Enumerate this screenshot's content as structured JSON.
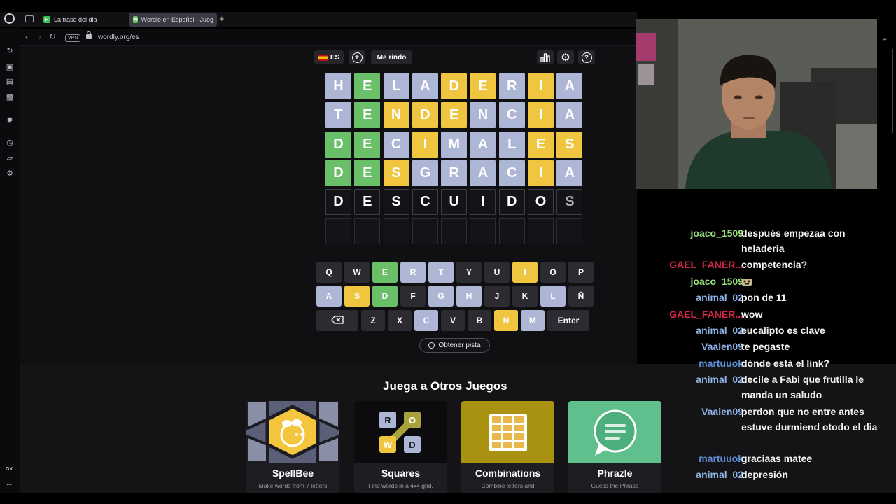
{
  "browser": {
    "tabs": [
      {
        "label": "La frase del dia",
        "favicon": "P",
        "favicon_color": "#3fbf5a"
      },
      {
        "label": "Wordle en Español - Jueg",
        "favicon": "W",
        "favicon_color": "#6ac068"
      }
    ],
    "new_tab": "+",
    "vpn_badge": "VPN",
    "url": "wordly.org/es"
  },
  "toolbar": {
    "language": "ES",
    "give_up": "Me rindo"
  },
  "board": {
    "rows": [
      {
        "letters": [
          "H",
          "E",
          "L",
          "A",
          "D",
          "E",
          "R",
          "I",
          "A"
        ],
        "states": [
          "x",
          "g",
          "x",
          "x",
          "y",
          "y",
          "x",
          "y",
          "x"
        ]
      },
      {
        "letters": [
          "T",
          "E",
          "N",
          "D",
          "E",
          "N",
          "C",
          "I",
          "A"
        ],
        "states": [
          "x",
          "g",
          "y",
          "y",
          "y",
          "x",
          "x",
          "y",
          "x"
        ]
      },
      {
        "letters": [
          "D",
          "E",
          "C",
          "I",
          "M",
          "A",
          "L",
          "E",
          "S"
        ],
        "states": [
          "g",
          "g",
          "x",
          "y",
          "x",
          "x",
          "x",
          "y",
          "y"
        ]
      },
      {
        "letters": [
          "D",
          "E",
          "S",
          "G",
          "R",
          "A",
          "C",
          "I",
          "A"
        ],
        "states": [
          "g",
          "g",
          "y",
          "x",
          "x",
          "x",
          "x",
          "y",
          "x"
        ]
      },
      {
        "letters": [
          "D",
          "E",
          "S",
          "C",
          "U",
          "I",
          "D",
          "O",
          "S"
        ],
        "states": [
          "cur",
          "cur",
          "cur",
          "cur",
          "cur",
          "cur",
          "cur",
          "cur",
          "cur"
        ]
      },
      {
        "letters": [
          "",
          "",
          "",
          "",
          "",
          "",
          "",
          "",
          ""
        ],
        "states": [
          "e",
          "e",
          "e",
          "e",
          "e",
          "e",
          "e",
          "e",
          "e"
        ]
      }
    ]
  },
  "keyboard": {
    "row1": [
      {
        "k": "Q",
        "s": ""
      },
      {
        "k": "W",
        "s": ""
      },
      {
        "k": "E",
        "s": "g"
      },
      {
        "k": "R",
        "s": "x"
      },
      {
        "k": "T",
        "s": "x"
      },
      {
        "k": "Y",
        "s": ""
      },
      {
        "k": "U",
        "s": ""
      },
      {
        "k": "I",
        "s": "y"
      },
      {
        "k": "O",
        "s": ""
      },
      {
        "k": "P",
        "s": ""
      }
    ],
    "row2": [
      {
        "k": "A",
        "s": "x"
      },
      {
        "k": "S",
        "s": "y"
      },
      {
        "k": "D",
        "s": "g"
      },
      {
        "k": "F",
        "s": ""
      },
      {
        "k": "G",
        "s": "x"
      },
      {
        "k": "H",
        "s": "x"
      },
      {
        "k": "J",
        "s": ""
      },
      {
        "k": "K",
        "s": ""
      },
      {
        "k": "L",
        "s": "x"
      },
      {
        "k": "Ñ",
        "s": ""
      }
    ],
    "row3": [
      {
        "k": "Z",
        "s": ""
      },
      {
        "k": "X",
        "s": ""
      },
      {
        "k": "C",
        "s": "x"
      },
      {
        "k": "V",
        "s": ""
      },
      {
        "k": "B",
        "s": ""
      },
      {
        "k": "N",
        "s": "y"
      },
      {
        "k": "M",
        "s": "x"
      }
    ],
    "enter": "Enter",
    "backspace_icon": "backspace-icon"
  },
  "hint_button": "Obtener pista",
  "other_games": {
    "title": "Juega a Otros Juegos",
    "cards": [
      {
        "name": "SpellBee",
        "desc": "Make words from 7 letters"
      },
      {
        "name": "Squares",
        "desc": "Find words in a 4x4 grid."
      },
      {
        "name": "Combinations",
        "desc": "Combine letters and"
      },
      {
        "name": "Phrazle",
        "desc": "Guess the Phrase"
      }
    ],
    "squares_letters": [
      "R",
      "O",
      "W",
      "D"
    ]
  },
  "sidebar": {
    "gx": "GX",
    "more": "..."
  },
  "chat": [
    {
      "user": "joaco_1509",
      "color": "#9be07c",
      "text": "después empezaa con heladeria",
      "lines": 2
    },
    {
      "user": "GAEL_FANER...",
      "color": "#d3264a",
      "text": "competencia?",
      "lines": 1
    },
    {
      "user": "joaco_1509",
      "color": "#9be07c",
      "text": "",
      "emote": true,
      "lines": 1
    },
    {
      "user": "animal_02",
      "color": "#8fb4e8",
      "text": "pon de 11",
      "lines": 1
    },
    {
      "user": "GAEL_FANER...",
      "color": "#d3264a",
      "text": "wow",
      "lines": 1
    },
    {
      "user": "animal_02",
      "color": "#8fb4e8",
      "text": "eucalipto es clave",
      "lines": 1
    },
    {
      "user": "Vaalen09",
      "color": "#8fb4e8",
      "text": "te pegaste",
      "lines": 1
    },
    {
      "user": "martuuok",
      "color": "#5e8fd6",
      "text": "dónde está el link?",
      "lines": 1
    },
    {
      "user": "animal_02",
      "color": "#8fb4e8",
      "text": "decile a Fabi que frutilla le manda un saludo",
      "lines": 2
    },
    {
      "user": "Vaalen09",
      "color": "#8fb4e8",
      "text": "perdon que no entre antes estuve durmiend otodo el dia",
      "lines": 3
    },
    {
      "user": "martuuok",
      "color": "#5e8fd6",
      "text": "graciaas matee",
      "lines": 1
    },
    {
      "user": "animal_02",
      "color": "#8fb4e8",
      "text": "depresión",
      "lines": 1
    }
  ]
}
